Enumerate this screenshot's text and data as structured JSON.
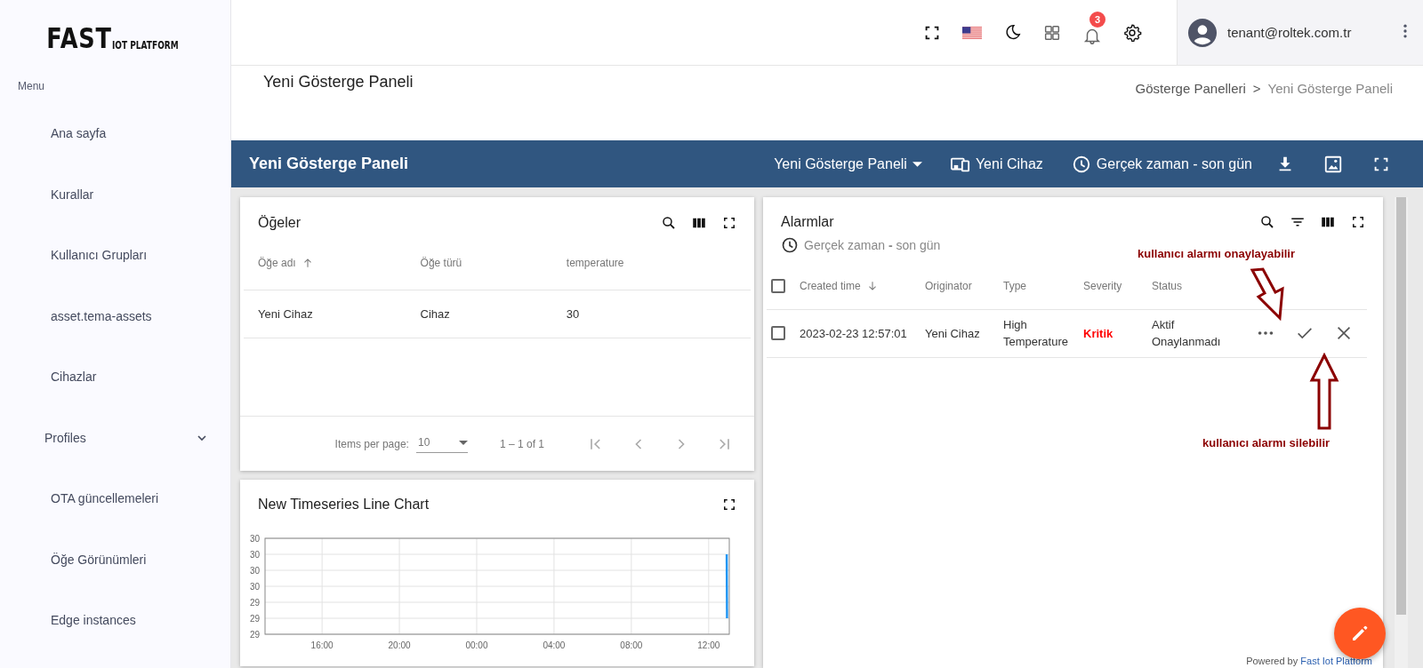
{
  "sidebar": {
    "logo": {
      "main": "FAST",
      "sub": "IOT PLATFORM"
    },
    "menu_label": "Menu",
    "items": [
      {
        "label": "Ana sayfa",
        "kind": "link"
      },
      {
        "label": "Kurallar",
        "kind": "link"
      },
      {
        "label": "Kullanıcı Grupları",
        "kind": "link"
      },
      {
        "label": "asset.tema-assets",
        "kind": "link"
      },
      {
        "label": "Cihazlar",
        "kind": "link"
      },
      {
        "label": "Profiles",
        "kind": "group",
        "expanded": false
      },
      {
        "label": "OTA güncellemeleri",
        "kind": "link"
      },
      {
        "label": "Öğe Görünümleri",
        "kind": "link"
      },
      {
        "label": "Edge instances",
        "kind": "link"
      }
    ]
  },
  "header": {
    "notification_count": "3",
    "user_email": "tenant@roltek.com.tr"
  },
  "page": {
    "title": "Yeni Gösterge Paneli",
    "breadcrumb": [
      "Gösterge Panelleri",
      "Yeni Gösterge Paneli"
    ],
    "breadcrumb_separator": ">"
  },
  "dashboard_bar": {
    "title": "Yeni Gösterge Paneli",
    "dashboard_select": "Yeni Gösterge Paneli",
    "entity": "Yeni Cihaz",
    "timewindow": "Gerçek zaman - son gün"
  },
  "assets_widget": {
    "title": "Öğeler",
    "sort_ascending": true,
    "columns": [
      {
        "label": "Öğe adı",
        "sorted": true
      },
      {
        "label": "Öğe türü",
        "sorted": false
      },
      {
        "label": "temperature",
        "sorted": false
      }
    ],
    "rows": [
      [
        "Yeni Cihaz",
        "Cihaz",
        "30"
      ]
    ],
    "paginator": {
      "label": "Items per page:",
      "page_size": "10",
      "range": "1 – 1 of 1",
      "buttons_disabled": true
    }
  },
  "chart_widget": {
    "title": "New Timeseries Line Chart",
    "chart_data": {
      "type": "line",
      "grid": true,
      "x": [
        "2023-02-23 12:56",
        "2023-02-23 12:57"
      ],
      "series": [
        {
          "color": "#2196f3",
          "values": [
            29.7,
            29.3
          ]
        }
      ],
      "xlim": [
        "2023-02-22 13:03",
        "2023-02-23 13:04"
      ],
      "ylim": [
        29.2,
        29.8
      ],
      "xticks": [
        {
          "value": "2023-02-22 16:00",
          "label": "16:00"
        },
        {
          "value": "2023-02-22 20:00",
          "label": "20:00"
        },
        {
          "value": "2023-02-23 00:00",
          "label": "00:00"
        },
        {
          "value": "2023-02-23 04:00",
          "label": "04:00"
        },
        {
          "value": "2023-02-23 08:00",
          "label": "08:00"
        },
        {
          "value": "2023-02-23 12:00",
          "label": "12:00"
        }
      ],
      "yticks": [
        {
          "value": 29.2,
          "label": "29"
        },
        {
          "value": 29.3,
          "label": "29"
        },
        {
          "value": 29.4,
          "label": "29"
        },
        {
          "value": 29.5,
          "label": "30"
        },
        {
          "value": 29.6,
          "label": "30"
        },
        {
          "value": 29.7,
          "label": "30"
        },
        {
          "value": 29.8,
          "label": "30"
        }
      ]
    }
  },
  "alarms_widget": {
    "title": "Alarmlar",
    "timewindow": "Gerçek zaman **-** son gün",
    "select_all_checked": false,
    "sort_ascending": false,
    "columns": [
      {
        "label": "Created time",
        "sorted": true
      },
      {
        "label": "Originator",
        "sorted": false
      },
      {
        "label": "Type",
        "sorted": false
      },
      {
        "label": "Severity",
        "sorted": false
      },
      {
        "label": "Status",
        "sorted": false
      }
    ],
    "rows": [
      {
        "checked": false,
        "created_time": "2023-02-23 12:57:01",
        "originator": "Yeni Cihaz",
        "type": "High Temperature",
        "severity": {
          "label": "Kritik",
          "color": "#ff0000"
        },
        "status": "Aktif Onaylanmadı"
      }
    ],
    "footer": {
      "prefix": "Powered by",
      "link": "Fast Iot Platform"
    }
  },
  "annotations": [
    {
      "text": "kullanıcı alarmı onaylayabilir",
      "kind": "diagonal"
    },
    {
      "text": "kullanıcı alarmı silebilir",
      "kind": "vertical"
    }
  ]
}
